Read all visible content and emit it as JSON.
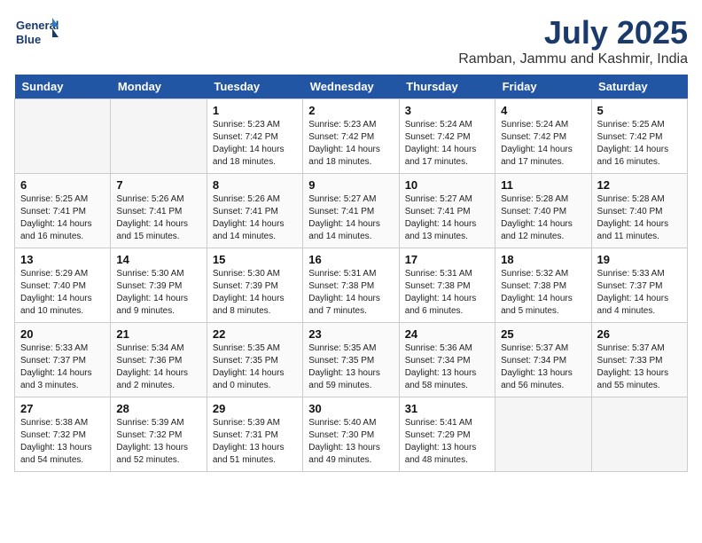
{
  "header": {
    "logo_line1": "General",
    "logo_line2": "Blue",
    "month_year": "July 2025",
    "location": "Ramban, Jammu and Kashmir, India"
  },
  "days_of_week": [
    "Sunday",
    "Monday",
    "Tuesday",
    "Wednesday",
    "Thursday",
    "Friday",
    "Saturday"
  ],
  "weeks": [
    [
      {
        "day": "",
        "empty": true
      },
      {
        "day": "",
        "empty": true
      },
      {
        "day": "1",
        "sunrise": "Sunrise: 5:23 AM",
        "sunset": "Sunset: 7:42 PM",
        "daylight": "Daylight: 14 hours and 18 minutes."
      },
      {
        "day": "2",
        "sunrise": "Sunrise: 5:23 AM",
        "sunset": "Sunset: 7:42 PM",
        "daylight": "Daylight: 14 hours and 18 minutes."
      },
      {
        "day": "3",
        "sunrise": "Sunrise: 5:24 AM",
        "sunset": "Sunset: 7:42 PM",
        "daylight": "Daylight: 14 hours and 17 minutes."
      },
      {
        "day": "4",
        "sunrise": "Sunrise: 5:24 AM",
        "sunset": "Sunset: 7:42 PM",
        "daylight": "Daylight: 14 hours and 17 minutes."
      },
      {
        "day": "5",
        "sunrise": "Sunrise: 5:25 AM",
        "sunset": "Sunset: 7:42 PM",
        "daylight": "Daylight: 14 hours and 16 minutes."
      }
    ],
    [
      {
        "day": "6",
        "sunrise": "Sunrise: 5:25 AM",
        "sunset": "Sunset: 7:41 PM",
        "daylight": "Daylight: 14 hours and 16 minutes."
      },
      {
        "day": "7",
        "sunrise": "Sunrise: 5:26 AM",
        "sunset": "Sunset: 7:41 PM",
        "daylight": "Daylight: 14 hours and 15 minutes."
      },
      {
        "day": "8",
        "sunrise": "Sunrise: 5:26 AM",
        "sunset": "Sunset: 7:41 PM",
        "daylight": "Daylight: 14 hours and 14 minutes."
      },
      {
        "day": "9",
        "sunrise": "Sunrise: 5:27 AM",
        "sunset": "Sunset: 7:41 PM",
        "daylight": "Daylight: 14 hours and 14 minutes."
      },
      {
        "day": "10",
        "sunrise": "Sunrise: 5:27 AM",
        "sunset": "Sunset: 7:41 PM",
        "daylight": "Daylight: 14 hours and 13 minutes."
      },
      {
        "day": "11",
        "sunrise": "Sunrise: 5:28 AM",
        "sunset": "Sunset: 7:40 PM",
        "daylight": "Daylight: 14 hours and 12 minutes."
      },
      {
        "day": "12",
        "sunrise": "Sunrise: 5:28 AM",
        "sunset": "Sunset: 7:40 PM",
        "daylight": "Daylight: 14 hours and 11 minutes."
      }
    ],
    [
      {
        "day": "13",
        "sunrise": "Sunrise: 5:29 AM",
        "sunset": "Sunset: 7:40 PM",
        "daylight": "Daylight: 14 hours and 10 minutes."
      },
      {
        "day": "14",
        "sunrise": "Sunrise: 5:30 AM",
        "sunset": "Sunset: 7:39 PM",
        "daylight": "Daylight: 14 hours and 9 minutes."
      },
      {
        "day": "15",
        "sunrise": "Sunrise: 5:30 AM",
        "sunset": "Sunset: 7:39 PM",
        "daylight": "Daylight: 14 hours and 8 minutes."
      },
      {
        "day": "16",
        "sunrise": "Sunrise: 5:31 AM",
        "sunset": "Sunset: 7:38 PM",
        "daylight": "Daylight: 14 hours and 7 minutes."
      },
      {
        "day": "17",
        "sunrise": "Sunrise: 5:31 AM",
        "sunset": "Sunset: 7:38 PM",
        "daylight": "Daylight: 14 hours and 6 minutes."
      },
      {
        "day": "18",
        "sunrise": "Sunrise: 5:32 AM",
        "sunset": "Sunset: 7:38 PM",
        "daylight": "Daylight: 14 hours and 5 minutes."
      },
      {
        "day": "19",
        "sunrise": "Sunrise: 5:33 AM",
        "sunset": "Sunset: 7:37 PM",
        "daylight": "Daylight: 14 hours and 4 minutes."
      }
    ],
    [
      {
        "day": "20",
        "sunrise": "Sunrise: 5:33 AM",
        "sunset": "Sunset: 7:37 PM",
        "daylight": "Daylight: 14 hours and 3 minutes."
      },
      {
        "day": "21",
        "sunrise": "Sunrise: 5:34 AM",
        "sunset": "Sunset: 7:36 PM",
        "daylight": "Daylight: 14 hours and 2 minutes."
      },
      {
        "day": "22",
        "sunrise": "Sunrise: 5:35 AM",
        "sunset": "Sunset: 7:35 PM",
        "daylight": "Daylight: 14 hours and 0 minutes."
      },
      {
        "day": "23",
        "sunrise": "Sunrise: 5:35 AM",
        "sunset": "Sunset: 7:35 PM",
        "daylight": "Daylight: 13 hours and 59 minutes."
      },
      {
        "day": "24",
        "sunrise": "Sunrise: 5:36 AM",
        "sunset": "Sunset: 7:34 PM",
        "daylight": "Daylight: 13 hours and 58 minutes."
      },
      {
        "day": "25",
        "sunrise": "Sunrise: 5:37 AM",
        "sunset": "Sunset: 7:34 PM",
        "daylight": "Daylight: 13 hours and 56 minutes."
      },
      {
        "day": "26",
        "sunrise": "Sunrise: 5:37 AM",
        "sunset": "Sunset: 7:33 PM",
        "daylight": "Daylight: 13 hours and 55 minutes."
      }
    ],
    [
      {
        "day": "27",
        "sunrise": "Sunrise: 5:38 AM",
        "sunset": "Sunset: 7:32 PM",
        "daylight": "Daylight: 13 hours and 54 minutes."
      },
      {
        "day": "28",
        "sunrise": "Sunrise: 5:39 AM",
        "sunset": "Sunset: 7:32 PM",
        "daylight": "Daylight: 13 hours and 52 minutes."
      },
      {
        "day": "29",
        "sunrise": "Sunrise: 5:39 AM",
        "sunset": "Sunset: 7:31 PM",
        "daylight": "Daylight: 13 hours and 51 minutes."
      },
      {
        "day": "30",
        "sunrise": "Sunrise: 5:40 AM",
        "sunset": "Sunset: 7:30 PM",
        "daylight": "Daylight: 13 hours and 49 minutes."
      },
      {
        "day": "31",
        "sunrise": "Sunrise: 5:41 AM",
        "sunset": "Sunset: 7:29 PM",
        "daylight": "Daylight: 13 hours and 48 minutes."
      },
      {
        "day": "",
        "empty": true
      },
      {
        "day": "",
        "empty": true
      }
    ]
  ]
}
